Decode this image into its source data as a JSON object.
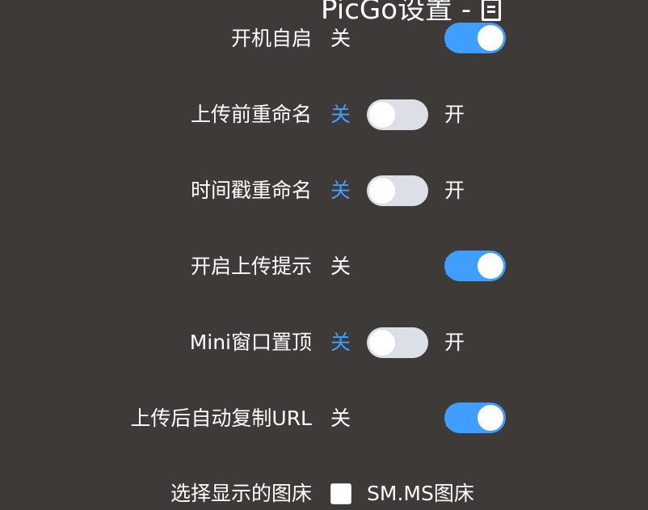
{
  "window": {
    "title": "PicGo设置 - "
  },
  "labels": {
    "off": "关",
    "on": "开"
  },
  "settings": [
    {
      "label": "开机自启",
      "enabled": true
    },
    {
      "label": "上传前重命名",
      "enabled": false
    },
    {
      "label": "时间戳重命名",
      "enabled": false
    },
    {
      "label": "开启上传提示",
      "enabled": true
    },
    {
      "label": "Mini窗口置顶",
      "enabled": false
    },
    {
      "label": "上传后自动复制URL",
      "enabled": true
    }
  ],
  "picbed_select": {
    "label": "选择显示的图床",
    "option": "SM.MS图床",
    "checked": false
  },
  "colors": {
    "background": "#3e3a37",
    "accent": "#409eff",
    "switch_off": "#dcdfe6"
  },
  "icons": {
    "title_icon": "document-icon"
  }
}
